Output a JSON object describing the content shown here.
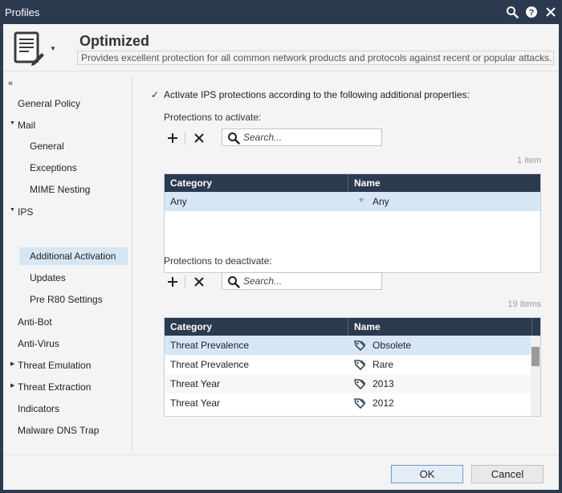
{
  "window": {
    "title": "Profiles",
    "icons": [
      "search-icon",
      "help-icon",
      "close-icon"
    ]
  },
  "profile": {
    "name": "Optimized",
    "description": "Provides excellent protection for all common network products and protocols against recent or popular attacks."
  },
  "sidebar": {
    "collapse_glyph": "«",
    "items": [
      {
        "label": "General Policy"
      },
      {
        "label": "Mail"
      },
      {
        "label": "General"
      },
      {
        "label": "Exceptions"
      },
      {
        "label": "MIME Nesting"
      },
      {
        "label": "IPS"
      },
      {
        "label": "Additional Activation"
      },
      {
        "label": "Updates"
      },
      {
        "label": "Pre R80 Settings"
      },
      {
        "label": "Anti-Bot"
      },
      {
        "label": "Anti-Virus"
      },
      {
        "label": "Threat Emulation"
      },
      {
        "label": "Threat Extraction"
      },
      {
        "label": "Indicators"
      },
      {
        "label": "Malware DNS Trap"
      }
    ]
  },
  "main": {
    "activate_checkbox_label": "Activate IPS protections according to the following additional properties:",
    "activate_checked": true,
    "activate_section": {
      "label": "Protections to activate:",
      "search_placeholder": "Search...",
      "count": "1 item",
      "columns": [
        "Category",
        "Name"
      ],
      "rows": [
        {
          "category": "Any",
          "name": "Any",
          "icon": "asterisk-icon"
        }
      ]
    },
    "deactivate_section": {
      "label": "Protections to deactivate:",
      "search_placeholder": "Search...",
      "count": "19 items",
      "columns": [
        "Category",
        "Name"
      ],
      "rows": [
        {
          "category": "Threat Prevalence",
          "name": "Obsolete",
          "icon": "tag-icon"
        },
        {
          "category": "Threat Prevalence",
          "name": "Rare",
          "icon": "tag-icon"
        },
        {
          "category": "Threat Year",
          "name": "2013",
          "icon": "tag-icon"
        },
        {
          "category": "Threat Year",
          "name": "2012",
          "icon": "tag-icon"
        }
      ]
    }
  },
  "footer": {
    "ok_label": "OK",
    "cancel_label": "Cancel"
  },
  "colors": {
    "titlebar": "#2b3a4f",
    "grid_header": "#2b3a4f",
    "selection": "#d6e6f5",
    "background": "#f4f4f4"
  }
}
